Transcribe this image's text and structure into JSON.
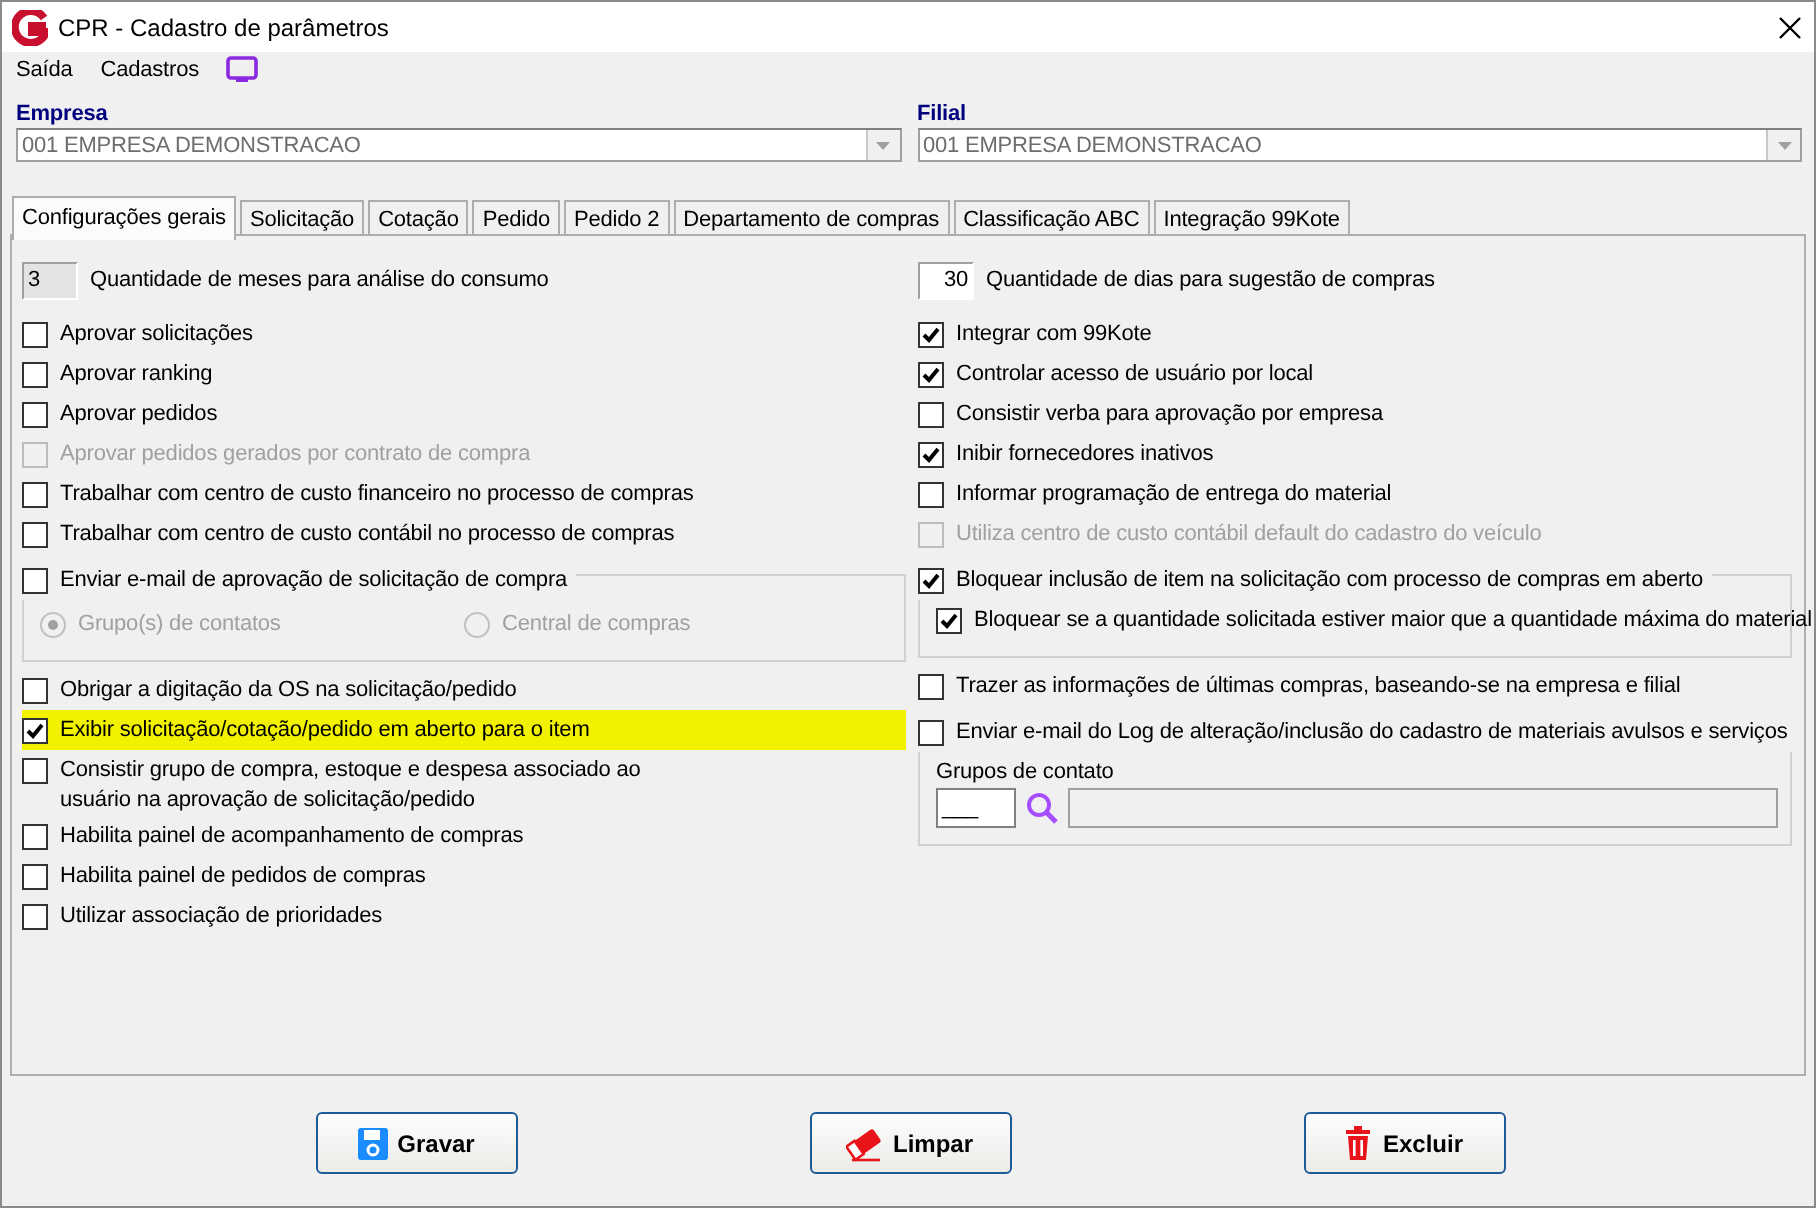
{
  "window": {
    "title": "CPR - Cadastro de parâmetros"
  },
  "menu": [
    {
      "label": "Saída"
    },
    {
      "label": "Cadastros"
    }
  ],
  "empresa": {
    "label": "Empresa",
    "value": "001 EMPRESA DEMONSTRACAO"
  },
  "filial": {
    "label": "Filial",
    "value": "001 EMPRESA DEMONSTRACAO"
  },
  "tabs": [
    {
      "label": "Configurações gerais",
      "selected": true
    },
    {
      "label": "Solicitação",
      "selected": false
    },
    {
      "label": "Cotação",
      "selected": false
    },
    {
      "label": "Pedido",
      "selected": false
    },
    {
      "label": "Pedido 2",
      "selected": false
    },
    {
      "label": "Departamento de compras",
      "selected": false
    },
    {
      "label": "Classificação ABC",
      "selected": false
    },
    {
      "label": "Integração 99Kote",
      "selected": false
    }
  ],
  "left": [
    {
      "kind": "number",
      "value": "3",
      "label": "Quantidade de meses para análise do consumo"
    },
    {
      "kind": "checkbox",
      "label": "Aprovar solicitações",
      "checked": false,
      "disabled": false,
      "highlighted": false
    },
    {
      "kind": "checkbox",
      "label": "Aprovar ranking",
      "checked": false,
      "disabled": false,
      "highlighted": false
    },
    {
      "kind": "checkbox",
      "label": "Aprovar pedidos",
      "checked": false,
      "disabled": false,
      "highlighted": false
    },
    {
      "kind": "checkbox",
      "label": "Aprovar pedidos gerados por contrato de compra",
      "checked": false,
      "disabled": true,
      "highlighted": false
    },
    {
      "kind": "checkbox",
      "label": "Trabalhar com centro de custo financeiro no processo de compras",
      "checked": false,
      "disabled": false,
      "highlighted": false
    },
    {
      "kind": "checkbox",
      "label": "Trabalhar com centro de custo contábil no processo de compras",
      "checked": false,
      "disabled": false,
      "highlighted": false
    },
    {
      "kind": "group",
      "label": "Enviar e-mail de aprovação de solicitação de compra",
      "checked": false,
      "disabled": false,
      "options": [
        {
          "kind": "radio",
          "label": "Grupo(s) de contatos",
          "selected": true,
          "disabled": true
        },
        {
          "kind": "radio",
          "label": "Central de compras",
          "selected": false,
          "disabled": true
        }
      ]
    },
    {
      "kind": "checkbox",
      "label": "Obrigar a digitação da OS na solicitação/pedido",
      "checked": false,
      "disabled": false,
      "highlighted": false
    },
    {
      "kind": "checkbox",
      "label": "Exibir solicitação/cotação/pedido em aberto para o item",
      "checked": true,
      "disabled": false,
      "highlighted": true
    },
    {
      "kind": "checkbox",
      "label": "Consistir grupo de compra, estoque e despesa associado ao usuário na aprovação de solicitação/pedido",
      "checked": false,
      "disabled": false,
      "highlighted": false
    },
    {
      "kind": "checkbox",
      "label": "Habilita painel de acompanhamento de compras",
      "checked": false,
      "disabled": false,
      "highlighted": false
    },
    {
      "kind": "checkbox",
      "label": "Habilita painel de pedidos de compras",
      "checked": false,
      "disabled": false,
      "highlighted": false
    },
    {
      "kind": "checkbox",
      "label": "Utilizar associação de prioridades",
      "checked": false,
      "disabled": false,
      "highlighted": false
    }
  ],
  "right": [
    {
      "kind": "number",
      "value": "30",
      "label": "Quantidade de dias para sugestão de compras"
    },
    {
      "kind": "checkbox",
      "label": "Integrar com 99Kote",
      "checked": true,
      "disabled": false,
      "highlighted": false
    },
    {
      "kind": "checkbox",
      "label": "Controlar acesso de usuário por local",
      "checked": true,
      "disabled": false,
      "highlighted": false
    },
    {
      "kind": "checkbox",
      "label": "Consistir verba para aprovação por empresa",
      "checked": false,
      "disabled": false,
      "highlighted": false
    },
    {
      "kind": "checkbox",
      "label": "Inibir fornecedores inativos",
      "checked": true,
      "disabled": false,
      "highlighted": false
    },
    {
      "kind": "checkbox",
      "label": "Informar programação de entrega do material",
      "checked": false,
      "disabled": false,
      "highlighted": false
    },
    {
      "kind": "checkbox",
      "label": "Utiliza centro de custo contábil default do cadastro do veículo",
      "checked": false,
      "disabled": true,
      "highlighted": false
    },
    {
      "kind": "group",
      "label": "Bloquear inclusão de item na solicitação com processo de compras em aberto",
      "checked": true,
      "disabled": false,
      "options": [
        {
          "kind": "checkbox",
          "label": "Bloquear se a quantidade solicitada estiver maior que a quantidade máxima do material",
          "checked": true,
          "disabled": false
        }
      ]
    },
    {
      "kind": "checkbox",
      "label": "Trazer as informações de últimas compras, baseando-se na empresa e filial",
      "checked": false,
      "disabled": false,
      "highlighted": false
    },
    {
      "kind": "group",
      "label": "Enviar e-mail do Log de alteração/inclusão do cadastro de materiais avulsos e serviços",
      "checked": false,
      "disabled": false,
      "options": [
        {
          "kind": "lookup",
          "label": "Grupos de contato",
          "value": "___"
        }
      ]
    }
  ],
  "buttons": [
    {
      "label": "Gravar",
      "kind": "save"
    },
    {
      "label": "Limpar",
      "kind": "clear"
    },
    {
      "label": "Excluir",
      "kind": "delete"
    }
  ]
}
